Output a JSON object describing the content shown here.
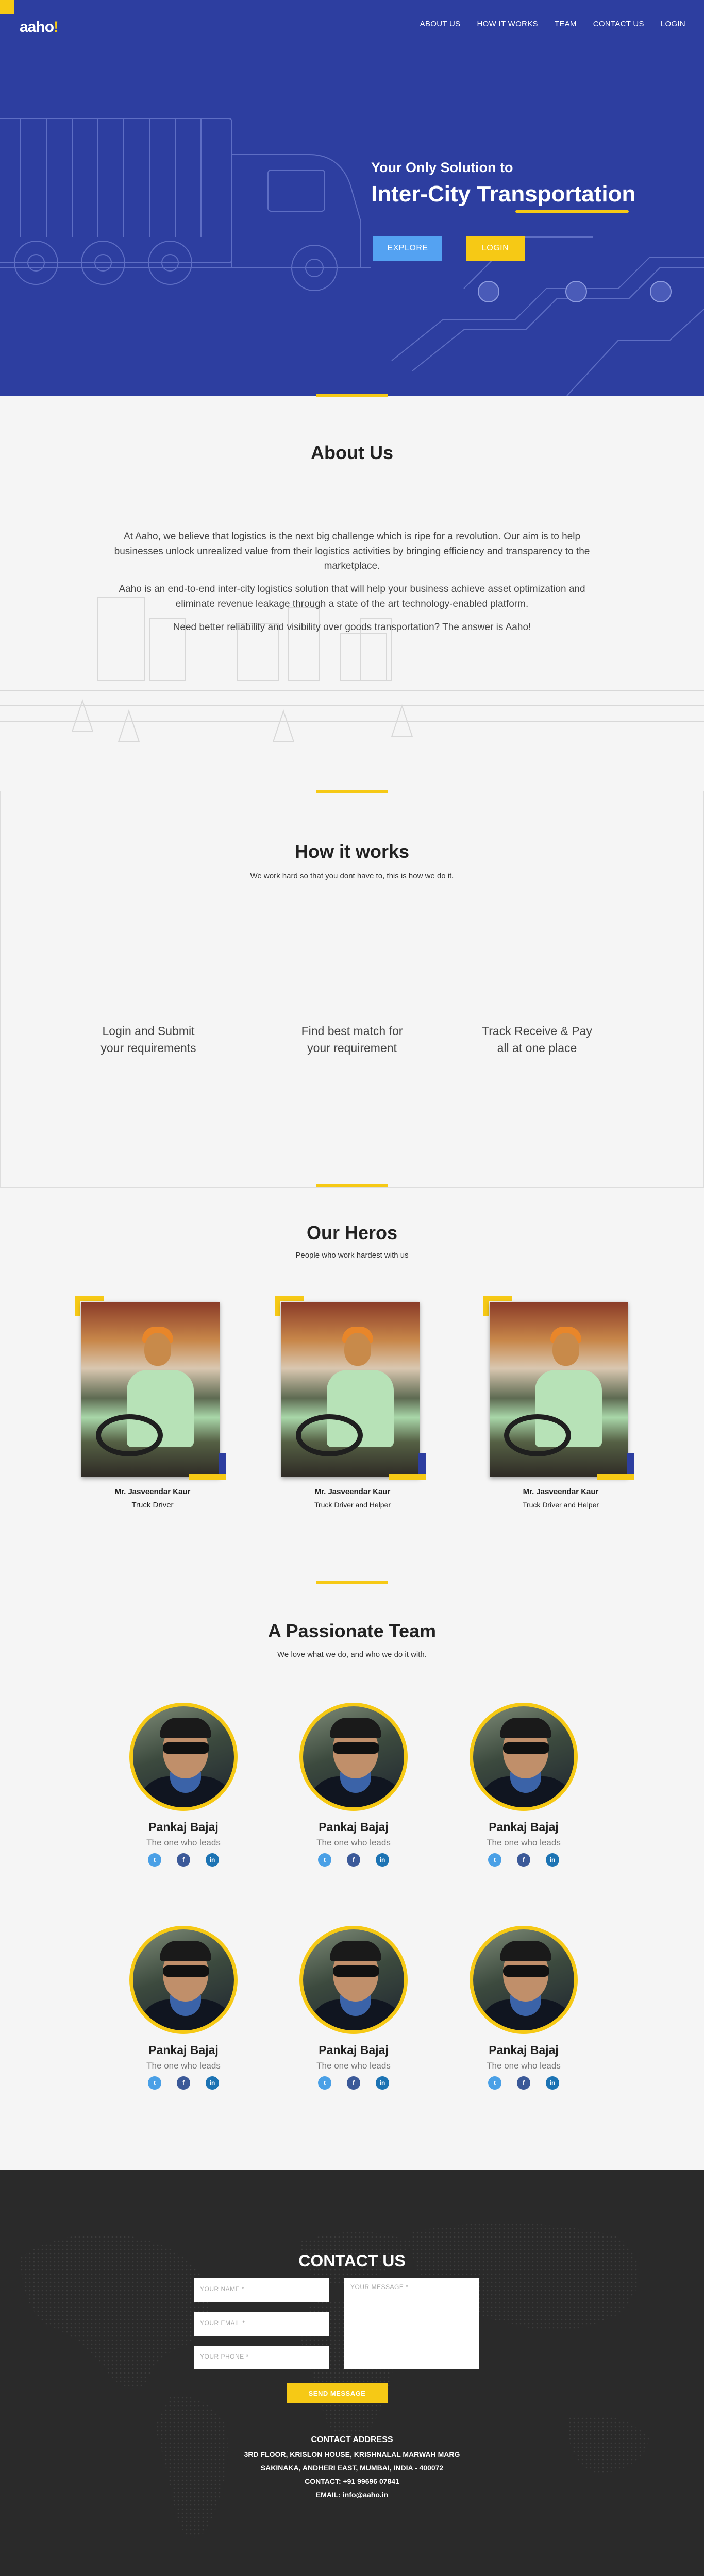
{
  "brand": {
    "logo_text": "aaho",
    "logo_dot": "!"
  },
  "nav": [
    {
      "label": "ABOUT US"
    },
    {
      "label": "HOW IT WORKS"
    },
    {
      "label": "TEAM"
    },
    {
      "label": "CONTACT US"
    },
    {
      "label": "LOGIN"
    }
  ],
  "hero": {
    "subtitle": "Your Only Solution to",
    "title": "Inter-City Transportation",
    "explore_label": "EXPLORE",
    "login_label": "LOGIN"
  },
  "about": {
    "title": "About Us",
    "paragraphs": [
      "At Aaho, we believe that logistics is the next big challenge which is ripe for a revolution. Our aim is to help businesses unlock unrealized value from their logistics activities by bringing efficiency and transparency to the marketplace.",
      "Aaho is an end-to-end inter-city logistics solution that will help your business achieve asset optimization and eliminate revenue leakage through a state of the art technology-enabled platform.",
      "Need better reliability and visibility over goods transportation? The answer is Aaho!"
    ]
  },
  "how": {
    "title": "How it works",
    "subtitle": "We work hard so that you dont have to, this is how we do it.",
    "steps": [
      {
        "line1": "Login and Submit",
        "line2": "your requirements"
      },
      {
        "line1": "Find best match for",
        "line2": "your requirement"
      },
      {
        "line1": "Track Receive & Pay",
        "line2": "all at one place"
      }
    ]
  },
  "heros": {
    "title": "Our Heros",
    "subtitle": "People who work hardest with us",
    "cards": [
      {
        "name": "Mr. Jasveendar Kaur",
        "role": "Truck Driver"
      },
      {
        "name": "Mr. Jasveendar Kaur",
        "role": "Truck Driver and Helper"
      },
      {
        "name": "Mr. Jasveendar Kaur",
        "role": "Truck Driver and Helper"
      }
    ]
  },
  "team": {
    "title": "A Passionate Team",
    "subtitle": "We love what we do, and who we do it with.",
    "members": [
      {
        "name": "Pankaj Bajaj",
        "role": "The one who leads"
      },
      {
        "name": "Pankaj Bajaj",
        "role": "The one who leads"
      },
      {
        "name": "Pankaj Bajaj",
        "role": "The one who leads"
      },
      {
        "name": "Pankaj Bajaj",
        "role": "The one who leads"
      },
      {
        "name": "Pankaj Bajaj",
        "role": "The one who leads"
      },
      {
        "name": "Pankaj Bajaj",
        "role": "The one who leads"
      }
    ],
    "social": {
      "twitter": "t",
      "facebook": "f",
      "linkedin": "in"
    }
  },
  "contact": {
    "title": "CONTACT US",
    "name_placeholder": "YOUR NAME *",
    "email_placeholder": "YOUR EMAIL *",
    "phone_placeholder": "YOUR PHONE *",
    "message_placeholder": "YOUR MESSAGE *",
    "send_label": "SEND MESSAGE",
    "address_title": "CONTACT ADDRESS",
    "address_line1": "3RD FLOOR, KRISLON HOUSE, KRISHNALAL MARWAH MARG",
    "address_line2": "SAKINAKA, ANDHERI EAST, MUMBAI, INDIA - 400072",
    "phone": "CONTACT: +91 99696 07841",
    "email": "EMAIL: info@aaho.in"
  },
  "colors": {
    "primary": "#2d3ea0",
    "accent": "#f6c915",
    "explore": "#54a2f2",
    "footer": "#2a2a2a"
  }
}
